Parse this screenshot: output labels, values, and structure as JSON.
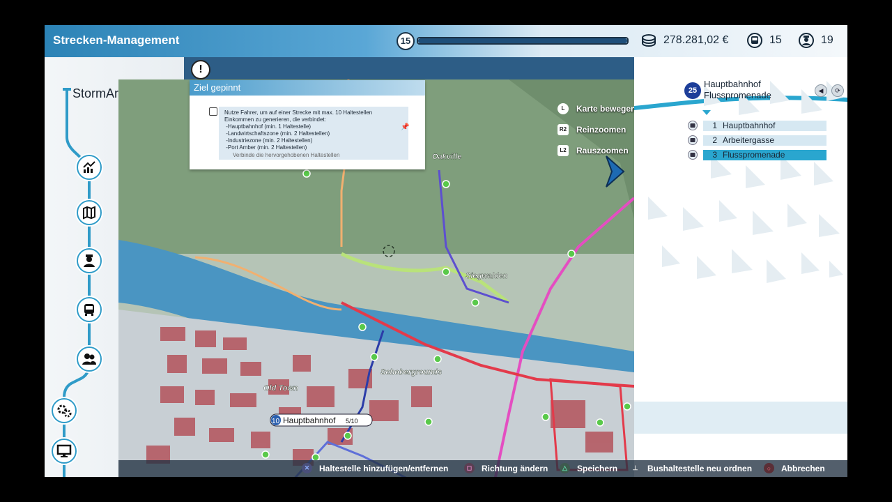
{
  "header": {
    "title": "Strecken-Management",
    "level": "15",
    "level_progress": 1.0,
    "money": "278.281,02 €",
    "buses": "15",
    "drivers": "19"
  },
  "sidebar": {
    "username": "StormArmy",
    "buttons": [
      "statistics-icon",
      "map-icon",
      "driver-icon",
      "bus-icon",
      "staff-icon",
      "settings-icon",
      "monitor-icon"
    ]
  },
  "goal": {
    "header": "Ziel gepinnt",
    "text": "Nutze Fahrer, um auf einer Strecke mit max. 10 Haltestellen\nEinkommen zu generieren, die verbindet:\n -Hauptbahnhof (min. 1 Haltestelle)\n -Landwirtschaftszone (min. 2 Haltestellen)\n -Industriezone (min. 2 Haltestellen)\n -Port Amber (min. 2 Haltestellen)",
    "subtext": "Verbinde die hervorgehobenen Haltestellen"
  },
  "map": {
    "labels": {
      "oakville": "Oakville",
      "siegwalden": "Siegwalden",
      "schobergrounds": "Schobergrounds",
      "oldtown": "Old Town"
    },
    "stop_tag": {
      "number": "10",
      "name": "Hauptbahnhof",
      "count": "5/10"
    }
  },
  "controls": [
    {
      "key": "L",
      "label": "Karte bewegen"
    },
    {
      "key": "R2",
      "label": "Reinzoomen"
    },
    {
      "key": "L2",
      "label": "Rauszoomen"
    }
  ],
  "route": {
    "number": "25",
    "name_line1": "Hauptbahnhof",
    "name_line2": "Flusspromenade",
    "stops": [
      {
        "num": "1",
        "name": "Hauptbahnhof"
      },
      {
        "num": "2",
        "name": "Arbeitergasse"
      },
      {
        "num": "3",
        "name": "Flusspromenade"
      }
    ]
  },
  "footer": [
    {
      "button": "cross",
      "label": "Haltestelle hinzufügen/entfernen"
    },
    {
      "button": "square",
      "label": "Richtung ändern"
    },
    {
      "button": "triangle",
      "label": "Speichern"
    },
    {
      "button": "R3",
      "label": "Bushaltestelle neu ordnen"
    },
    {
      "button": "circle",
      "label": "Abbrechen"
    }
  ],
  "colors": {
    "accent": "#2aa6cf",
    "header": "#2c83b6",
    "route_badge": "#1d3e99"
  }
}
